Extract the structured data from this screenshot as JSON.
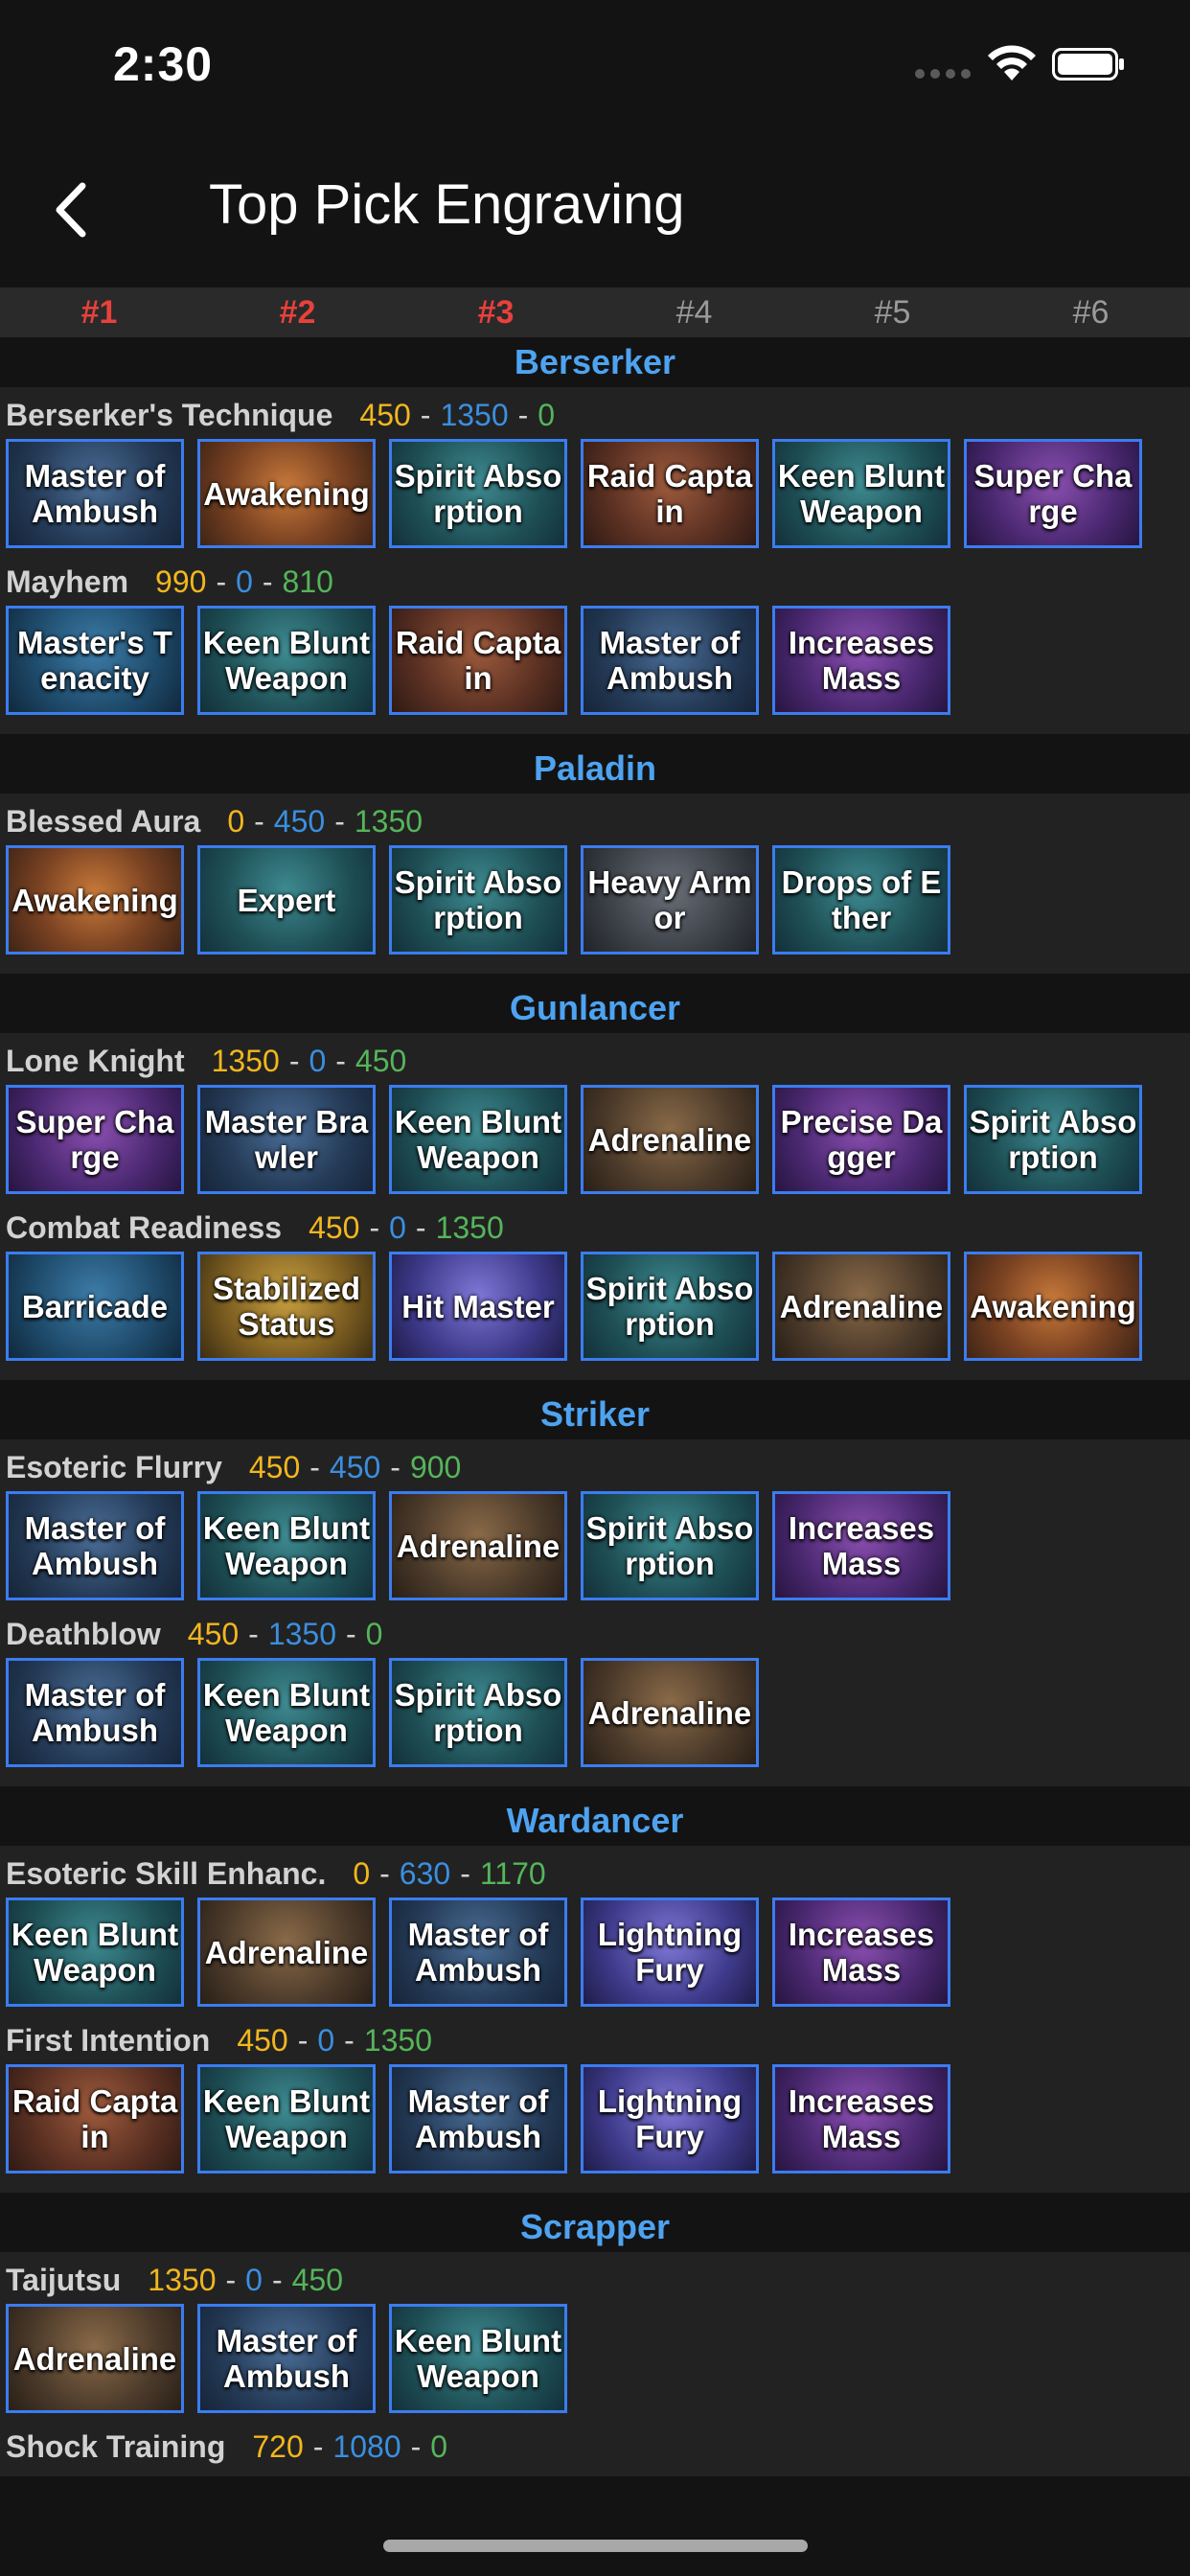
{
  "status": {
    "time": "2:30"
  },
  "header": {
    "title": "Top Pick Engraving"
  },
  "tabs": [
    {
      "label": "#1",
      "active": true
    },
    {
      "label": "#2",
      "active": true
    },
    {
      "label": "#3",
      "active": true
    },
    {
      "label": "#4",
      "active": false
    },
    {
      "label": "#5",
      "active": false
    },
    {
      "label": "#6",
      "active": false
    }
  ],
  "colors": {
    "accent_red": "#e8413c",
    "class_blue": "#4ea3f0",
    "value_yellow": "#f2b71e",
    "value_blue": "#3a8fe0",
    "value_green": "#55b55a",
    "tile_border": "#3b7cf0"
  },
  "classes": [
    {
      "name": "Berserker",
      "builds": [
        {
          "name": "Berserker's Technique",
          "v1": "450",
          "v2": "1350",
          "v3": "0",
          "engravings": [
            {
              "label": "Master of Ambush",
              "bg": "blue"
            },
            {
              "label": "Awakening",
              "bg": "orange"
            },
            {
              "label": "Spirit Absorption",
              "bg": "teal"
            },
            {
              "label": "Raid Captain",
              "bg": "red"
            },
            {
              "label": "Keen Blunt Weapon",
              "bg": "teal"
            },
            {
              "label": "Super Charge",
              "bg": "purple"
            }
          ]
        },
        {
          "name": "Mayhem",
          "v1": "990",
          "v2": "0",
          "v3": "810",
          "engravings": [
            {
              "label": "Master's Tenacity",
              "bg": "sky"
            },
            {
              "label": "Keen Blunt Weapon",
              "bg": "teal"
            },
            {
              "label": "Raid Captain",
              "bg": "red"
            },
            {
              "label": "Master of Ambush",
              "bg": "blue"
            },
            {
              "label": "Increases Mass",
              "bg": "purple"
            }
          ]
        }
      ]
    },
    {
      "name": "Paladin",
      "builds": [
        {
          "name": "Blessed Aura",
          "v1": "0",
          "v2": "450",
          "v3": "1350",
          "engravings": [
            {
              "label": "Awakening",
              "bg": "orange"
            },
            {
              "label": "Expert",
              "bg": "teal"
            },
            {
              "label": "Spirit Absorption",
              "bg": "teal"
            },
            {
              "label": "Heavy Armor",
              "bg": "steel"
            },
            {
              "label": "Drops of Ether",
              "bg": "teal"
            }
          ]
        }
      ]
    },
    {
      "name": "Gunlancer",
      "builds": [
        {
          "name": "Lone Knight",
          "v1": "1350",
          "v2": "0",
          "v3": "450",
          "engravings": [
            {
              "label": "Super Charge",
              "bg": "purple"
            },
            {
              "label": "Master Brawler",
              "bg": "blue"
            },
            {
              "label": "Keen Blunt Weapon",
              "bg": "teal"
            },
            {
              "label": "Adrenaline",
              "bg": "brown"
            },
            {
              "label": "Precise Dagger",
              "bg": "purple"
            },
            {
              "label": "Spirit Absorption",
              "bg": "teal"
            }
          ]
        },
        {
          "name": "Combat Readiness",
          "v1": "450",
          "v2": "0",
          "v3": "1350",
          "engravings": [
            {
              "label": "Barricade",
              "bg": "sky"
            },
            {
              "label": "Stabilized Status",
              "bg": "gold"
            },
            {
              "label": "Hit Master",
              "bg": "violet"
            },
            {
              "label": "Spirit Absorption",
              "bg": "teal"
            },
            {
              "label": "Adrenaline",
              "bg": "brown"
            },
            {
              "label": "Awakening",
              "bg": "orange"
            }
          ]
        }
      ]
    },
    {
      "name": "Striker",
      "builds": [
        {
          "name": "Esoteric Flurry",
          "v1": "450",
          "v2": "450",
          "v3": "900",
          "engravings": [
            {
              "label": "Master of Ambush",
              "bg": "blue"
            },
            {
              "label": "Keen Blunt Weapon",
              "bg": "teal"
            },
            {
              "label": "Adrenaline",
              "bg": "brown"
            },
            {
              "label": "Spirit Absorption",
              "bg": "teal"
            },
            {
              "label": "Increases Mass",
              "bg": "purple"
            }
          ]
        },
        {
          "name": "Deathblow",
          "v1": "450",
          "v2": "1350",
          "v3": "0",
          "engravings": [
            {
              "label": "Master of Ambush",
              "bg": "blue"
            },
            {
              "label": "Keen Blunt Weapon",
              "bg": "teal"
            },
            {
              "label": "Spirit Absorption",
              "bg": "teal"
            },
            {
              "label": "Adrenaline",
              "bg": "brown"
            }
          ]
        }
      ]
    },
    {
      "name": "Wardancer",
      "builds": [
        {
          "name": "Esoteric Skill Enhanc.",
          "v1": "0",
          "v2": "630",
          "v3": "1170",
          "engravings": [
            {
              "label": "Keen Blunt Weapon",
              "bg": "teal"
            },
            {
              "label": "Adrenaline",
              "bg": "brown"
            },
            {
              "label": "Master of Ambush",
              "bg": "blue"
            },
            {
              "label": "Lightning Fury",
              "bg": "violet"
            },
            {
              "label": "Increases Mass",
              "bg": "purple"
            }
          ]
        },
        {
          "name": "First Intention",
          "v1": "450",
          "v2": "0",
          "v3": "1350",
          "engravings": [
            {
              "label": "Raid Captain",
              "bg": "red"
            },
            {
              "label": "Keen Blunt Weapon",
              "bg": "teal"
            },
            {
              "label": "Master of Ambush",
              "bg": "blue"
            },
            {
              "label": "Lightning Fury",
              "bg": "violet"
            },
            {
              "label": "Increases Mass",
              "bg": "purple"
            }
          ]
        }
      ]
    },
    {
      "name": "Scrapper",
      "builds": [
        {
          "name": "Taijutsu",
          "v1": "1350",
          "v2": "0",
          "v3": "450",
          "engravings": [
            {
              "label": "Adrenaline",
              "bg": "brown"
            },
            {
              "label": "Master of Ambush",
              "bg": "blue"
            },
            {
              "label": "Keen Blunt Weapon",
              "bg": "teal"
            }
          ]
        },
        {
          "name": "Shock Training",
          "v1": "720",
          "v2": "1080",
          "v3": "0",
          "engravings": []
        }
      ]
    }
  ]
}
